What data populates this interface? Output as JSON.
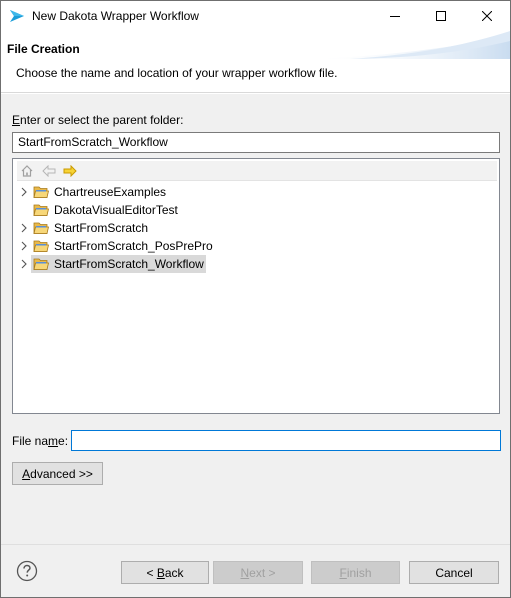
{
  "window": {
    "title": "New Dakota Wrapper Workflow"
  },
  "banner": {
    "title": "File Creation",
    "description": "Choose the name and location of your wrapper workflow file."
  },
  "folder": {
    "label_mnemonic": "E",
    "label_rest": "nter or select the parent folder:",
    "value": "StartFromScratch_Workflow"
  },
  "tree": {
    "items": [
      {
        "label": "ChartreuseExamples",
        "expandable": true,
        "selected": false
      },
      {
        "label": "DakotaVisualEditorTest",
        "expandable": false,
        "selected": false
      },
      {
        "label": "StartFromScratch",
        "expandable": true,
        "selected": false
      },
      {
        "label": "StartFromScratch_PosPrePro",
        "expandable": true,
        "selected": false
      },
      {
        "label": "StartFromScratch_Workflow",
        "expandable": true,
        "selected": true
      }
    ]
  },
  "file": {
    "label_pre": "File na",
    "label_mnemonic": "m",
    "label_post": "e:",
    "value": ""
  },
  "buttons": {
    "advanced_mnemonic": "A",
    "advanced_rest": "dvanced >>",
    "back_pre": "< ",
    "back_mnemonic": "B",
    "back_rest": "ack",
    "next_mnemonic": "N",
    "next_rest": "ext >",
    "finish_mnemonic": "F",
    "finish_rest": "inish",
    "cancel": "Cancel"
  },
  "colors": {
    "selection": "#d9d9d9",
    "focus_border": "#0078d7",
    "folder_yellow": "#f5c842",
    "eclipse_blue": "#1b9dd9"
  }
}
